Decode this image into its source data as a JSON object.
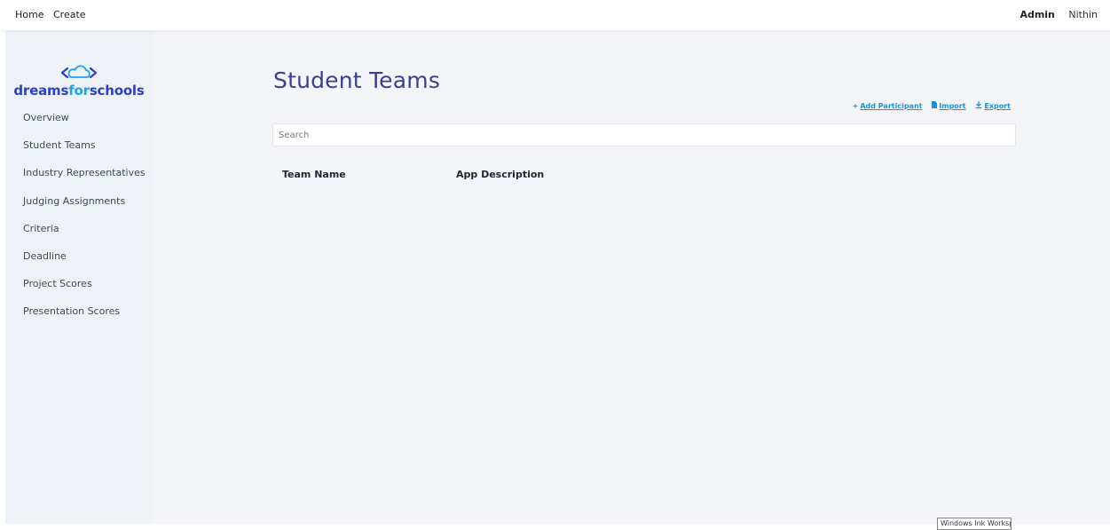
{
  "topnav": {
    "home": "Home",
    "create": "Create"
  },
  "user": {
    "role": "Admin",
    "name": "Nithin"
  },
  "logo": {
    "part1": "dreams",
    "part2": "for",
    "part3": "schools",
    "icon": "cloud-code-icon"
  },
  "sidebar": {
    "items": [
      {
        "label": "Overview"
      },
      {
        "label": "Student Teams"
      },
      {
        "label": "Industry Representatives"
      },
      {
        "label": "Judging Assignments"
      },
      {
        "label": "Criteria"
      },
      {
        "label": "Deadline"
      },
      {
        "label": "Project Scores"
      },
      {
        "label": "Presentation Scores"
      }
    ]
  },
  "page": {
    "title": "Student Teams"
  },
  "actions": {
    "add": {
      "label": "Add Participant",
      "icon": "plus-icon"
    },
    "import": {
      "label": "Import",
      "icon": "file-icon"
    },
    "export": {
      "label": "Export",
      "icon": "download-icon"
    }
  },
  "search": {
    "placeholder": "Search",
    "value": ""
  },
  "table": {
    "columns": [
      "Team Name",
      "App Description"
    ],
    "rows": []
  },
  "tooltip": {
    "text": "Windows Ink Workspace"
  },
  "colors": {
    "brand": "#2d3fc4",
    "brand_accent": "#1fa3e8",
    "title": "#3b3f8f",
    "link": "#1b92d8",
    "sidebar_bg": "#eef2f6",
    "main_bg": "#f4f5f9"
  }
}
